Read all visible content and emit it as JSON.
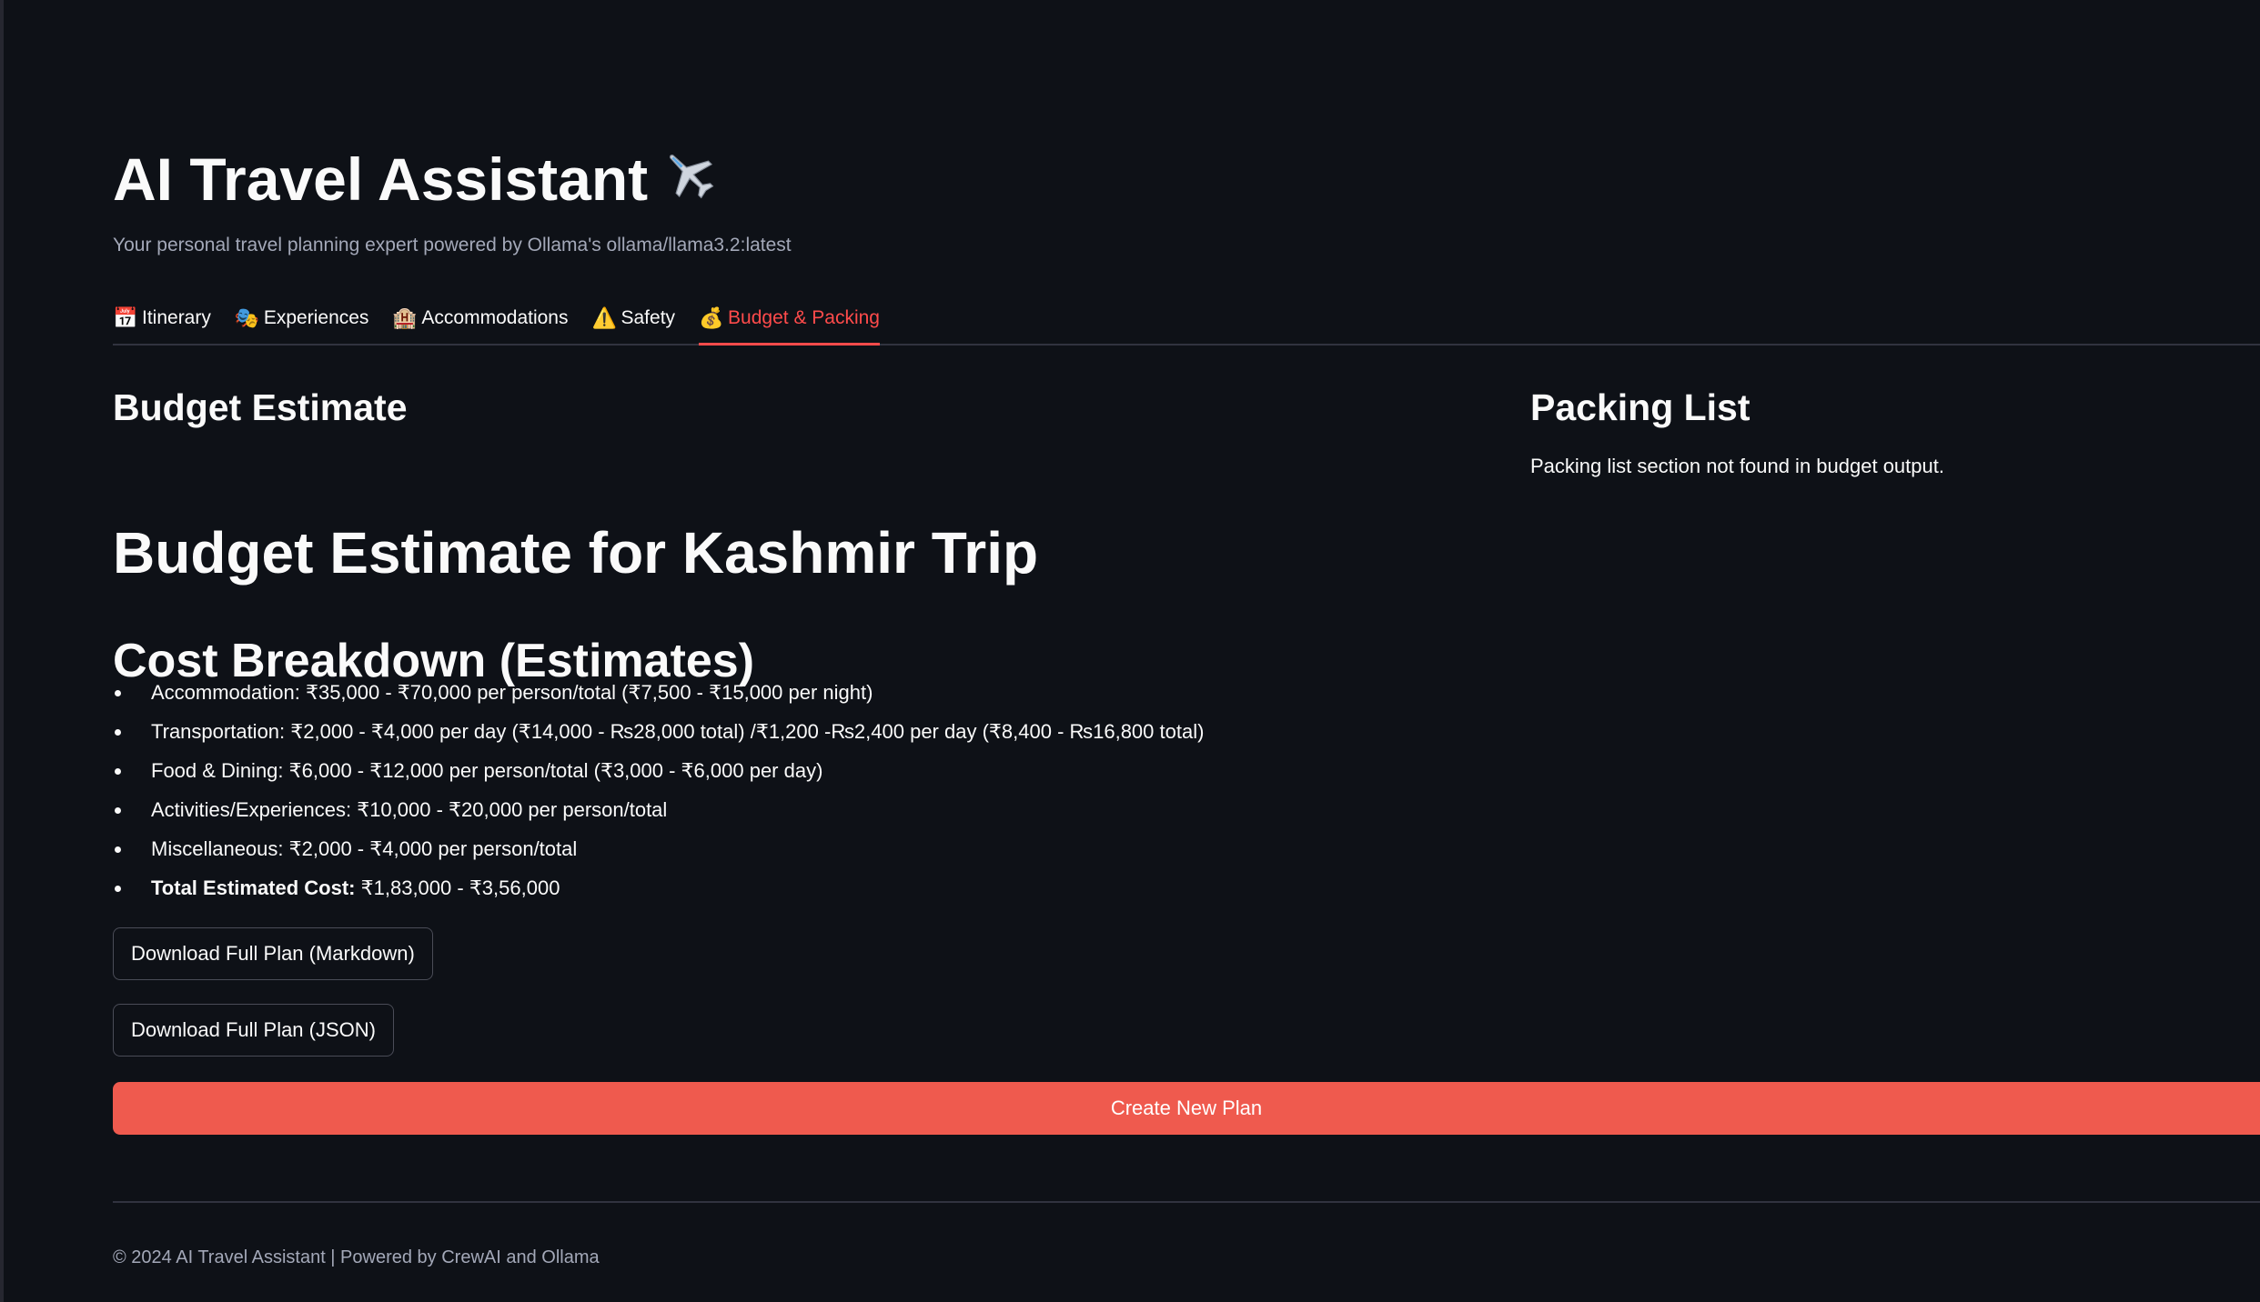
{
  "app": {
    "title": "AI Travel Assistant",
    "title_icon": "airplane-icon",
    "subtitle": "Your personal travel planning expert powered by Ollama's ollama/llama3.2:latest"
  },
  "tabs": [
    {
      "icon": "calendar-icon",
      "glyph": "📅",
      "label": "Itinerary",
      "active": false
    },
    {
      "icon": "performing-arts-icon",
      "glyph": "🎭",
      "label": "Experiences",
      "active": false
    },
    {
      "icon": "hotel-icon",
      "glyph": "🏨",
      "label": "Accommodations",
      "active": false
    },
    {
      "icon": "warning-icon",
      "glyph": "⚠️",
      "label": "Safety",
      "active": false
    },
    {
      "icon": "money-bag-icon",
      "glyph": "💰",
      "label": "Budget & Packing",
      "active": true
    }
  ],
  "budget": {
    "section_title": "Budget Estimate",
    "heading": "Budget Estimate for Kashmir Trip",
    "subheading": "Cost Breakdown (Estimates)",
    "items": [
      "Accommodation: ₹35,000 - ₹70,000 per person/total (₹7,500 - ₹15,000 per night)",
      "Transportation: ₹2,000 - ₹4,000 per day (₹14,000 - ₨28,000 total) /₹1,200 -₨2,400 per day (₹8,400 - ₨16,800 total)",
      "Food & Dining: ₹6,000 - ₹12,000 per person/total (₹3,000 - ₹6,000 per day)",
      "Activities/Experiences: ₹10,000 - ₹20,000 per person/total",
      "Miscellaneous: ₹2,000 - ₹4,000 per person/total"
    ],
    "total_label": "Total Estimated Cost:",
    "total_value": " ₹1,83,000 - ₹3,56,000"
  },
  "packing": {
    "section_title": "Packing List",
    "message": "Packing list section not found in budget output."
  },
  "buttons": {
    "download_markdown": "Download Full Plan (Markdown)",
    "download_json": "Download Full Plan (JSON)",
    "create_new": "Create New Plan"
  },
  "footer": {
    "text": "© 2024 AI Travel Assistant | Powered by CrewAI and Ollama"
  },
  "colors": {
    "background": "#0e1117",
    "accent": "#ff4b4b",
    "primary_button": "#ef5a4e"
  }
}
